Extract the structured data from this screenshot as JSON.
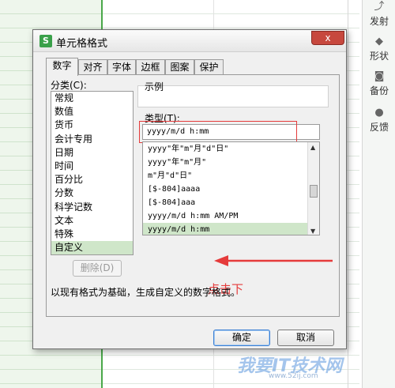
{
  "dialog": {
    "title": "单元格格式",
    "close_label": "x",
    "tabs": [
      "数字",
      "对齐",
      "字体",
      "边框",
      "图案",
      "保护"
    ],
    "category_label": "分类(C):",
    "categories": [
      "常规",
      "数值",
      "货币",
      "会计专用",
      "日期",
      "时间",
      "百分比",
      "分数",
      "科学记数",
      "文本",
      "特殊",
      "自定义"
    ],
    "selected_category": "自定义",
    "sample_label": "示例",
    "type_label": "类型(T):",
    "type_value": "yyyy/m/d h:mm",
    "formats": [
      "yyyy\"年\"m\"月\"d\"日\"",
      "yyyy\"年\"m\"月\"",
      "m\"月\"d\"日\"",
      "[$-804]aaaa",
      "[$-804]aaa",
      "yyyy/m/d h:mm AM/PM",
      "yyyy/m/d h:mm"
    ],
    "selected_format": "yyyy/m/d h:mm",
    "delete_label": "删除(D)",
    "description": "以现有格式为基础，生成自定义的数字格式。",
    "ok_label": "确定",
    "cancel_label": "取消"
  },
  "annotation": "点击下",
  "sidebar": {
    "items": [
      "发射",
      "形状",
      "备份",
      "反馈"
    ]
  },
  "watermark": {
    "text": "我要IT技术网",
    "sub": "www.52ij.com"
  },
  "colors": {
    "accent_green": "#3aa04a",
    "highlight_red": "#e53b3b",
    "selection": "#cfe6c9"
  }
}
